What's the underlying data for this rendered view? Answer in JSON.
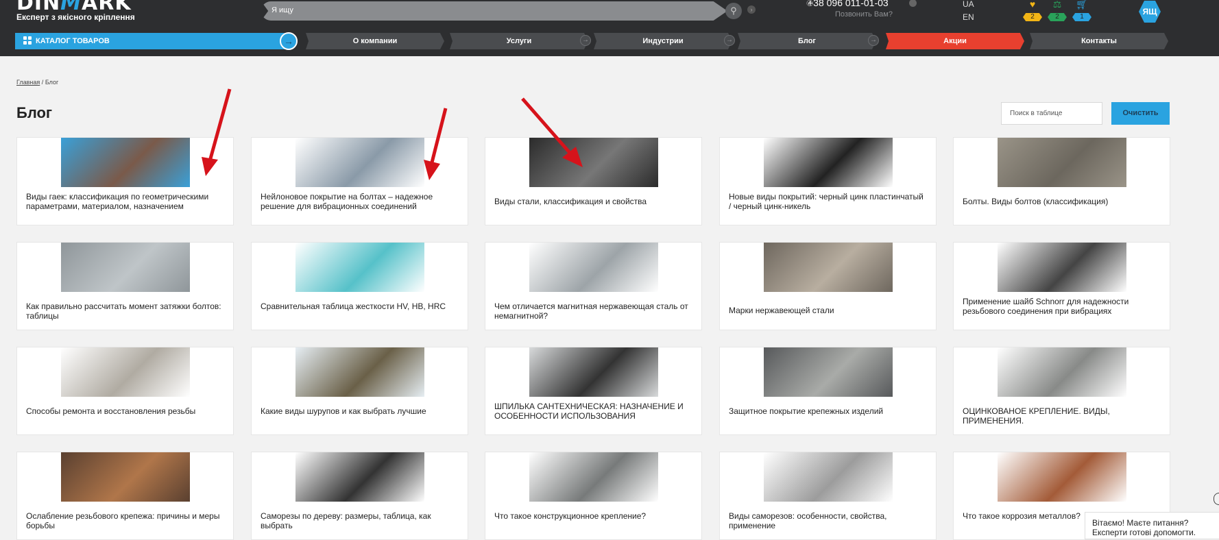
{
  "header": {
    "logo_main": "DIN",
    "logo_accent": "M",
    "logo_tail": "ARK",
    "tagline": "Експерт з якісного кріплення",
    "search_placeholder": "Я ищу",
    "phone": "+38 096 011-01-03",
    "callback": "Позвонить Вам?",
    "lang_ua": "UA",
    "lang_en": "EN",
    "favorites_count": "2",
    "compare_count": "2",
    "cart_count": "1",
    "avatar": "ЯЩ",
    "colors": {
      "brand_blue": "#2aa3e0",
      "sale_red": "#e8402f",
      "badge_yellow": "#f2b516",
      "badge_green": "#29a35a",
      "badge_blue": "#2aa3e0"
    }
  },
  "nav": {
    "catalog": "КАТАЛОГ ТОВАРОВ",
    "about": "О компании",
    "services": "Услуги",
    "industries": "Индустрии",
    "blog": "Блог",
    "sale": "Акции",
    "contacts": "Контакты"
  },
  "breadcrumb": {
    "home": "Главная",
    "sep": "/",
    "current": "Блог"
  },
  "page_title": "Блог",
  "table_search_placeholder": "Поиск в таблице",
  "clear_button": "Очистить",
  "articles": [
    {
      "title": "Виды гаек: классификация по геометрическими параметрами, материалом, назначением",
      "thumb": "copper-nuts-photo"
    },
    {
      "title": "Нейлоновое покрытие на болтах – надежное решение для вибрационных соединений",
      "thumb": "nylon-coated-bolts-photo"
    },
    {
      "title": "Виды стали, классификация и свойства",
      "thumb": "steel-fasteners-photo"
    },
    {
      "title": "Новые виды покрытий: черный цинк пластинчатый / черный цинк-никель",
      "thumb": "black-washers-photo"
    },
    {
      "title": "Болты. Виды болтов (классификация)",
      "thumb": "bolts-pile-photo"
    },
    {
      "title": "Как правильно рассчитать момент затяжки болтов: таблицы",
      "thumb": "bolt-thread-closeup-photo"
    },
    {
      "title": "Сравнительная таблица жесткости HV, HB, HRC",
      "thumb": "hardness-diagram"
    },
    {
      "title": "Чем отличается магнитная нержавеющая сталь от немагнитной?",
      "thumb": "stainless-bolts-photo"
    },
    {
      "title": "Марки нержавеющей стали",
      "thumb": "stainless-hex-bolts-photo"
    },
    {
      "title": "Применение шайб Schnorr для надежности резьбового соединения при вибрациях",
      "thumb": "schnorr-washers-photo"
    },
    {
      "title": "Способы ремонта и восстановления резьбы",
      "thumb": "thread-inserts-photo"
    },
    {
      "title": "Какие виды шурупов и как выбрать лучшие",
      "thumb": "wood-screws-photo"
    },
    {
      "title": "ШПИЛЬКА САНТЕХНИЧЕСКАЯ: НАЗНАЧЕНИЕ И ОСОБЕННОСТИ ИСПОЛЬЗОВАНИЯ",
      "thumb": "plumbing-studs-photo"
    },
    {
      "title": "Защитное покрытие крепежных изделий",
      "thumb": "coated-bolts-photo"
    },
    {
      "title": "ОЦИНКОВАНОЕ КРЕПЛЕНИЕ. ВИДЫ, ПРИМЕНЕНИЯ.",
      "thumb": "galvanized-bolts-photo"
    },
    {
      "title": "Ослабление резьбового крепежа: причины и меры борьбы",
      "thumb": "workshop-photo"
    },
    {
      "title": "Саморезы по дереву: размеры, таблица, как выбрать",
      "thumb": "black-screws-photo"
    },
    {
      "title": "Что такое конструкционное крепление?",
      "thumb": "structural-bolt-photo"
    },
    {
      "title": "Виды саморезов: особенности, свойства, применение",
      "thumb": "self-tapping-screws-photo"
    },
    {
      "title": "Что такое коррозия металлов?",
      "thumb": "rusty-bolt-photo"
    }
  ],
  "chat_text": "Вітаємо! Маєте питання? Експерти готові допомогти."
}
